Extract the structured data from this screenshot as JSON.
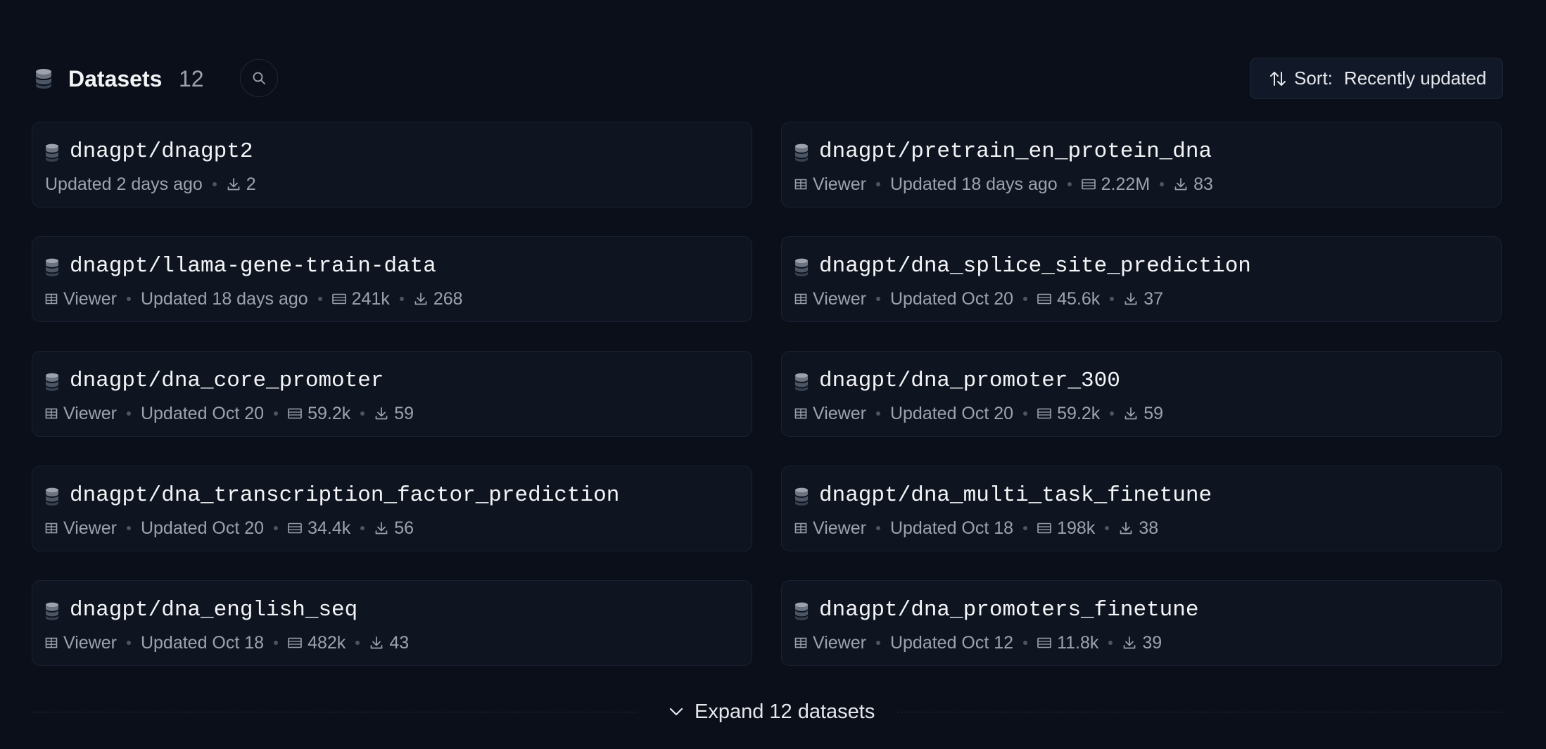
{
  "header": {
    "title": "Datasets",
    "count": "12",
    "sort_prefix": "Sort:",
    "sort_value": "Recently updated",
    "icons": {
      "section": "database-icon",
      "search": "search-icon",
      "sort": "sort-arrows-icon"
    }
  },
  "colors": {
    "background": "#0b0f19",
    "card": "#0e1420",
    "border": "#1a2233",
    "text": "#f3f4f6",
    "muted": "#9ca3af"
  },
  "datasets": [
    {
      "name": "dnagpt/dnagpt2",
      "viewer": "",
      "updated": "Updated 2 days ago",
      "rows": "",
      "downloads": "2"
    },
    {
      "name": "dnagpt/pretrain_en_protein_dna",
      "viewer": "Viewer",
      "updated": "Updated 18 days ago",
      "rows": "2.22M",
      "downloads": "83"
    },
    {
      "name": "dnagpt/llama-gene-train-data",
      "viewer": "Viewer",
      "updated": "Updated 18 days ago",
      "rows": "241k",
      "downloads": "268"
    },
    {
      "name": "dnagpt/dna_splice_site_prediction",
      "viewer": "Viewer",
      "updated": "Updated Oct 20",
      "rows": "45.6k",
      "downloads": "37"
    },
    {
      "name": "dnagpt/dna_core_promoter",
      "viewer": "Viewer",
      "updated": "Updated Oct 20",
      "rows": "59.2k",
      "downloads": "59"
    },
    {
      "name": "dnagpt/dna_promoter_300",
      "viewer": "Viewer",
      "updated": "Updated Oct 20",
      "rows": "59.2k",
      "downloads": "59"
    },
    {
      "name": "dnagpt/dna_transcription_factor_prediction",
      "viewer": "Viewer",
      "updated": "Updated Oct 20",
      "rows": "34.4k",
      "downloads": "56"
    },
    {
      "name": "dnagpt/dna_multi_task_finetune",
      "viewer": "Viewer",
      "updated": "Updated Oct 18",
      "rows": "198k",
      "downloads": "38"
    },
    {
      "name": "dnagpt/dna_english_seq",
      "viewer": "Viewer",
      "updated": "Updated Oct 18",
      "rows": "482k",
      "downloads": "43"
    },
    {
      "name": "dnagpt/dna_promoters_finetune",
      "viewer": "Viewer",
      "updated": "Updated Oct 12",
      "rows": "11.8k",
      "downloads": "39"
    }
  ],
  "expand_label": "Expand 12 datasets"
}
